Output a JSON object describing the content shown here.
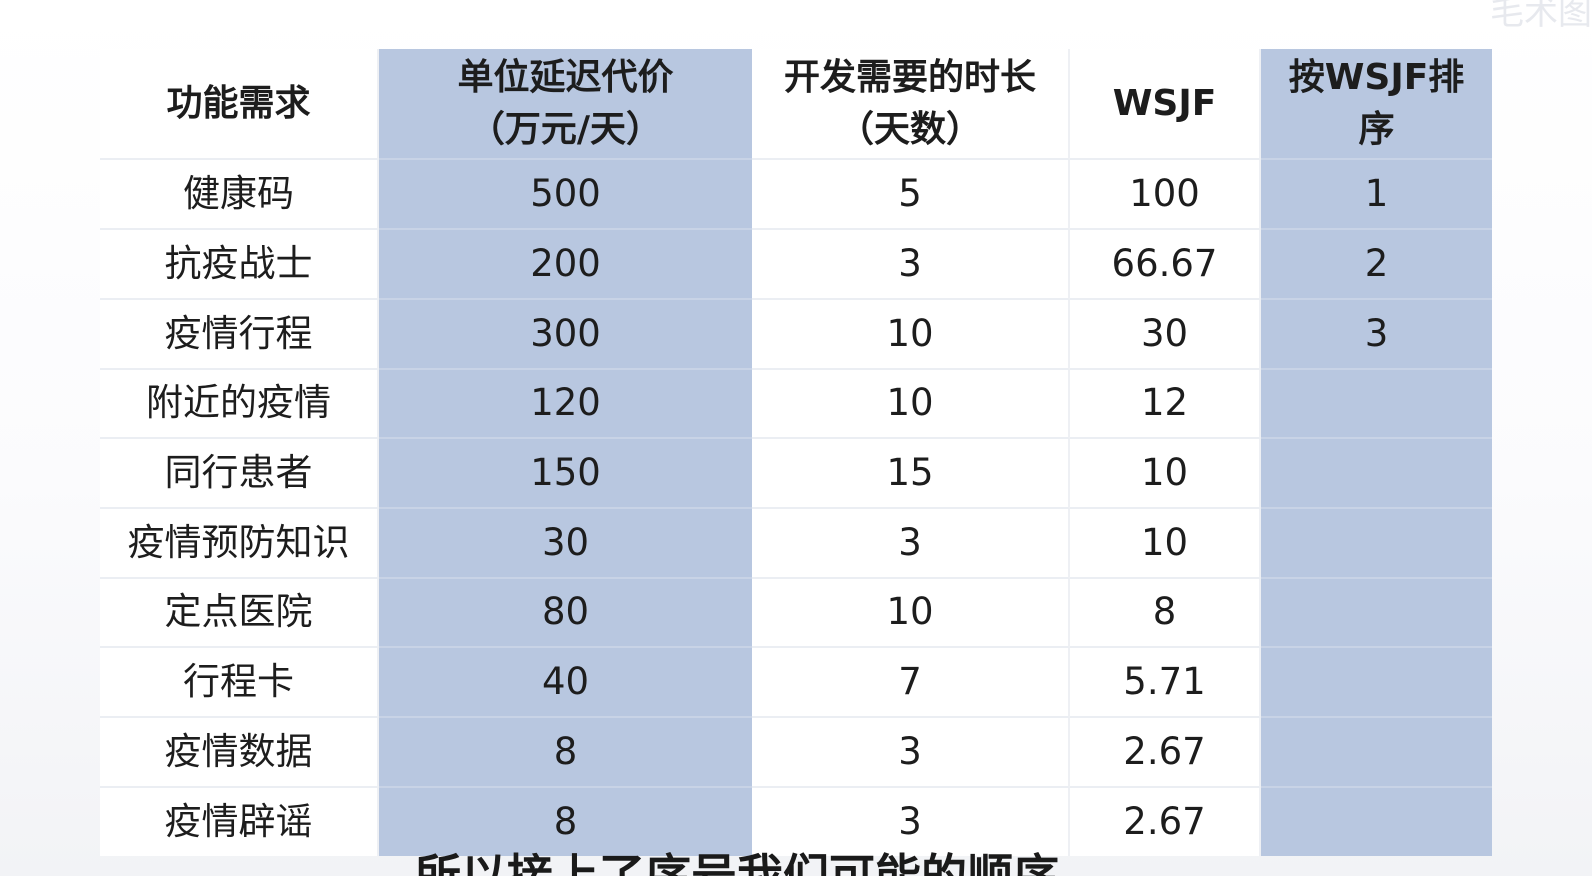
{
  "table": {
    "headers": [
      [
        "功能需求"
      ],
      [
        "单位延迟代价",
        "（万元/天）"
      ],
      [
        "开发需要的时长",
        "（天数）"
      ],
      [
        "WSJF"
      ],
      [
        "按WSJF排",
        "序"
      ]
    ],
    "rows": [
      [
        "健康码",
        "500",
        "5",
        "100",
        "1"
      ],
      [
        "抗疫战士",
        "200",
        "3",
        "66.67",
        "2"
      ],
      [
        "疫情行程",
        "300",
        "10",
        "30",
        "3"
      ],
      [
        "附近的疫情",
        "120",
        "10",
        "12",
        ""
      ],
      [
        "同行患者",
        "150",
        "15",
        "10",
        ""
      ],
      [
        "疫情预防知识",
        "30",
        "3",
        "10",
        ""
      ],
      [
        "定点医院",
        "80",
        "10",
        "8",
        ""
      ],
      [
        "行程卡",
        "40",
        "7",
        "5.71",
        ""
      ],
      [
        "疫情数据",
        "8",
        "3",
        "2.67",
        ""
      ],
      [
        "疫情辟谣",
        "8",
        "3",
        "2.67",
        ""
      ]
    ],
    "colors": {
      "highlight_column": "#b8c7e0",
      "plain_column": "#ffffff",
      "text": "#1d1d1d"
    }
  },
  "subtitle": "所以接上了序号我们可能的顺序",
  "watermark": "毛术图"
}
